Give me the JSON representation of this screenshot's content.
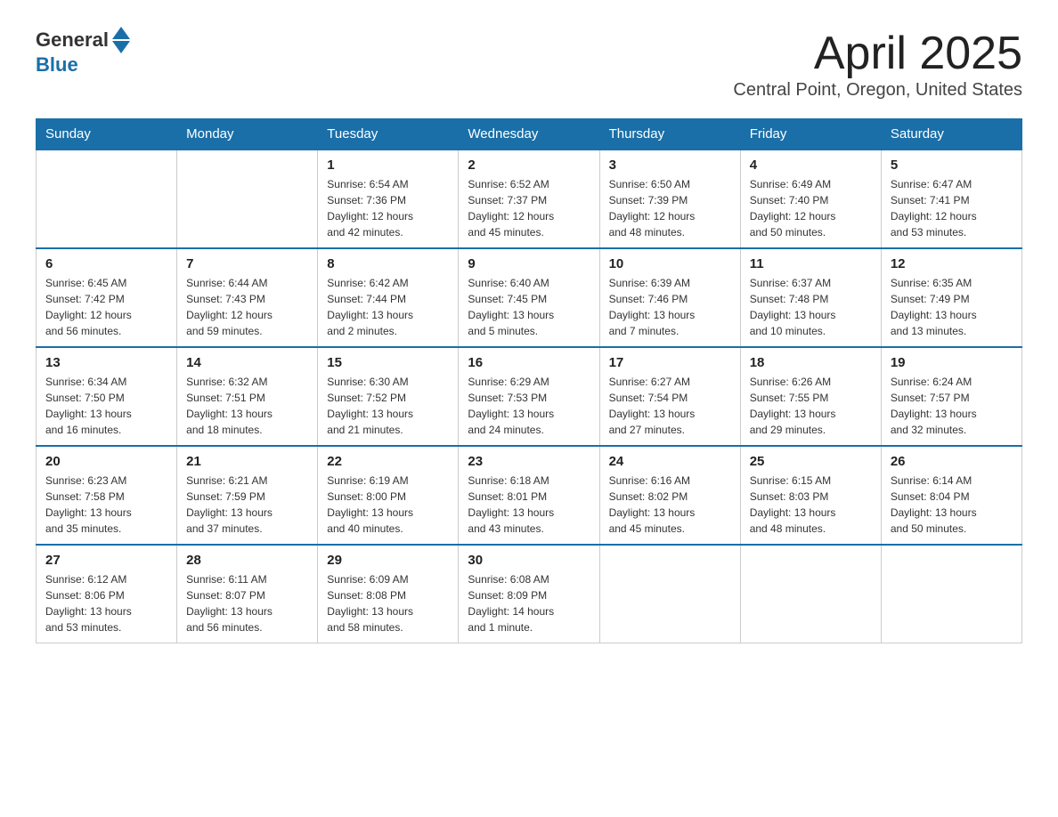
{
  "header": {
    "logo_general": "General",
    "logo_blue": "Blue",
    "title": "April 2025",
    "subtitle": "Central Point, Oregon, United States"
  },
  "days_of_week": [
    "Sunday",
    "Monday",
    "Tuesday",
    "Wednesday",
    "Thursday",
    "Friday",
    "Saturday"
  ],
  "weeks": [
    [
      {
        "day": "",
        "info": ""
      },
      {
        "day": "",
        "info": ""
      },
      {
        "day": "1",
        "info": "Sunrise: 6:54 AM\nSunset: 7:36 PM\nDaylight: 12 hours\nand 42 minutes."
      },
      {
        "day": "2",
        "info": "Sunrise: 6:52 AM\nSunset: 7:37 PM\nDaylight: 12 hours\nand 45 minutes."
      },
      {
        "day": "3",
        "info": "Sunrise: 6:50 AM\nSunset: 7:39 PM\nDaylight: 12 hours\nand 48 minutes."
      },
      {
        "day": "4",
        "info": "Sunrise: 6:49 AM\nSunset: 7:40 PM\nDaylight: 12 hours\nand 50 minutes."
      },
      {
        "day": "5",
        "info": "Sunrise: 6:47 AM\nSunset: 7:41 PM\nDaylight: 12 hours\nand 53 minutes."
      }
    ],
    [
      {
        "day": "6",
        "info": "Sunrise: 6:45 AM\nSunset: 7:42 PM\nDaylight: 12 hours\nand 56 minutes."
      },
      {
        "day": "7",
        "info": "Sunrise: 6:44 AM\nSunset: 7:43 PM\nDaylight: 12 hours\nand 59 minutes."
      },
      {
        "day": "8",
        "info": "Sunrise: 6:42 AM\nSunset: 7:44 PM\nDaylight: 13 hours\nand 2 minutes."
      },
      {
        "day": "9",
        "info": "Sunrise: 6:40 AM\nSunset: 7:45 PM\nDaylight: 13 hours\nand 5 minutes."
      },
      {
        "day": "10",
        "info": "Sunrise: 6:39 AM\nSunset: 7:46 PM\nDaylight: 13 hours\nand 7 minutes."
      },
      {
        "day": "11",
        "info": "Sunrise: 6:37 AM\nSunset: 7:48 PM\nDaylight: 13 hours\nand 10 minutes."
      },
      {
        "day": "12",
        "info": "Sunrise: 6:35 AM\nSunset: 7:49 PM\nDaylight: 13 hours\nand 13 minutes."
      }
    ],
    [
      {
        "day": "13",
        "info": "Sunrise: 6:34 AM\nSunset: 7:50 PM\nDaylight: 13 hours\nand 16 minutes."
      },
      {
        "day": "14",
        "info": "Sunrise: 6:32 AM\nSunset: 7:51 PM\nDaylight: 13 hours\nand 18 minutes."
      },
      {
        "day": "15",
        "info": "Sunrise: 6:30 AM\nSunset: 7:52 PM\nDaylight: 13 hours\nand 21 minutes."
      },
      {
        "day": "16",
        "info": "Sunrise: 6:29 AM\nSunset: 7:53 PM\nDaylight: 13 hours\nand 24 minutes."
      },
      {
        "day": "17",
        "info": "Sunrise: 6:27 AM\nSunset: 7:54 PM\nDaylight: 13 hours\nand 27 minutes."
      },
      {
        "day": "18",
        "info": "Sunrise: 6:26 AM\nSunset: 7:55 PM\nDaylight: 13 hours\nand 29 minutes."
      },
      {
        "day": "19",
        "info": "Sunrise: 6:24 AM\nSunset: 7:57 PM\nDaylight: 13 hours\nand 32 minutes."
      }
    ],
    [
      {
        "day": "20",
        "info": "Sunrise: 6:23 AM\nSunset: 7:58 PM\nDaylight: 13 hours\nand 35 minutes."
      },
      {
        "day": "21",
        "info": "Sunrise: 6:21 AM\nSunset: 7:59 PM\nDaylight: 13 hours\nand 37 minutes."
      },
      {
        "day": "22",
        "info": "Sunrise: 6:19 AM\nSunset: 8:00 PM\nDaylight: 13 hours\nand 40 minutes."
      },
      {
        "day": "23",
        "info": "Sunrise: 6:18 AM\nSunset: 8:01 PM\nDaylight: 13 hours\nand 43 minutes."
      },
      {
        "day": "24",
        "info": "Sunrise: 6:16 AM\nSunset: 8:02 PM\nDaylight: 13 hours\nand 45 minutes."
      },
      {
        "day": "25",
        "info": "Sunrise: 6:15 AM\nSunset: 8:03 PM\nDaylight: 13 hours\nand 48 minutes."
      },
      {
        "day": "26",
        "info": "Sunrise: 6:14 AM\nSunset: 8:04 PM\nDaylight: 13 hours\nand 50 minutes."
      }
    ],
    [
      {
        "day": "27",
        "info": "Sunrise: 6:12 AM\nSunset: 8:06 PM\nDaylight: 13 hours\nand 53 minutes."
      },
      {
        "day": "28",
        "info": "Sunrise: 6:11 AM\nSunset: 8:07 PM\nDaylight: 13 hours\nand 56 minutes."
      },
      {
        "day": "29",
        "info": "Sunrise: 6:09 AM\nSunset: 8:08 PM\nDaylight: 13 hours\nand 58 minutes."
      },
      {
        "day": "30",
        "info": "Sunrise: 6:08 AM\nSunset: 8:09 PM\nDaylight: 14 hours\nand 1 minute."
      },
      {
        "day": "",
        "info": ""
      },
      {
        "day": "",
        "info": ""
      },
      {
        "day": "",
        "info": ""
      }
    ]
  ]
}
